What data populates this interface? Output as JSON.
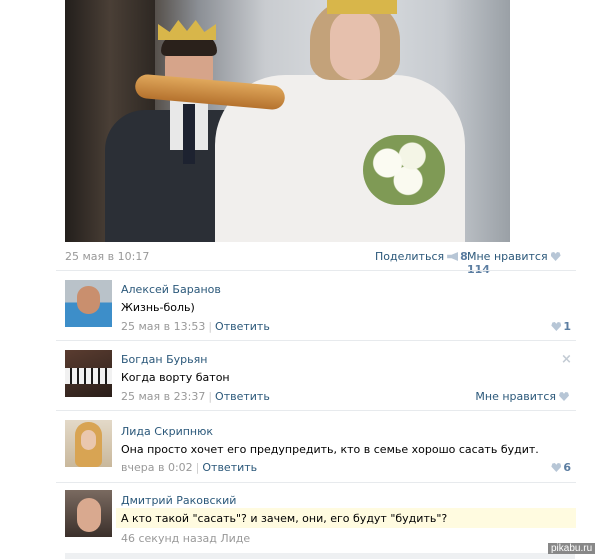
{
  "post": {
    "date": "25 мая в 10:17",
    "share_label": "Поделиться",
    "share_count": "8",
    "like_label": "Мне нравится",
    "like_count": "114"
  },
  "comments": [
    {
      "author": "Алексей Баранов",
      "text": "Жизнь-боль)",
      "time": "25 мая в 13:53",
      "reply_label": "Ответить",
      "like_count": "1"
    },
    {
      "author": "Богдан Бурьян",
      "text": "Когда ворту батон",
      "time": "25 мая в 23:37",
      "reply_label": "Ответить",
      "like_label": "Мне нравится",
      "close_icon": "×"
    },
    {
      "author": "Лида Скрипнюк",
      "text": "Она просто хочет его предупредить, кто в семье хорошо сасать будит.",
      "time": "вчера в 0:02",
      "reply_label": "Ответить",
      "like_count": "6"
    },
    {
      "author": "Дмитрий Раковский",
      "text": "А кто такой \"сасать\"? и зачем, они, его будут \"будить\"?",
      "time": "46 секунд назад Лиде"
    }
  ],
  "watermark": "pikabu.ru",
  "colors": {
    "link": "#2b587a",
    "meta": "#999999",
    "highlight": "#fffbe0"
  }
}
